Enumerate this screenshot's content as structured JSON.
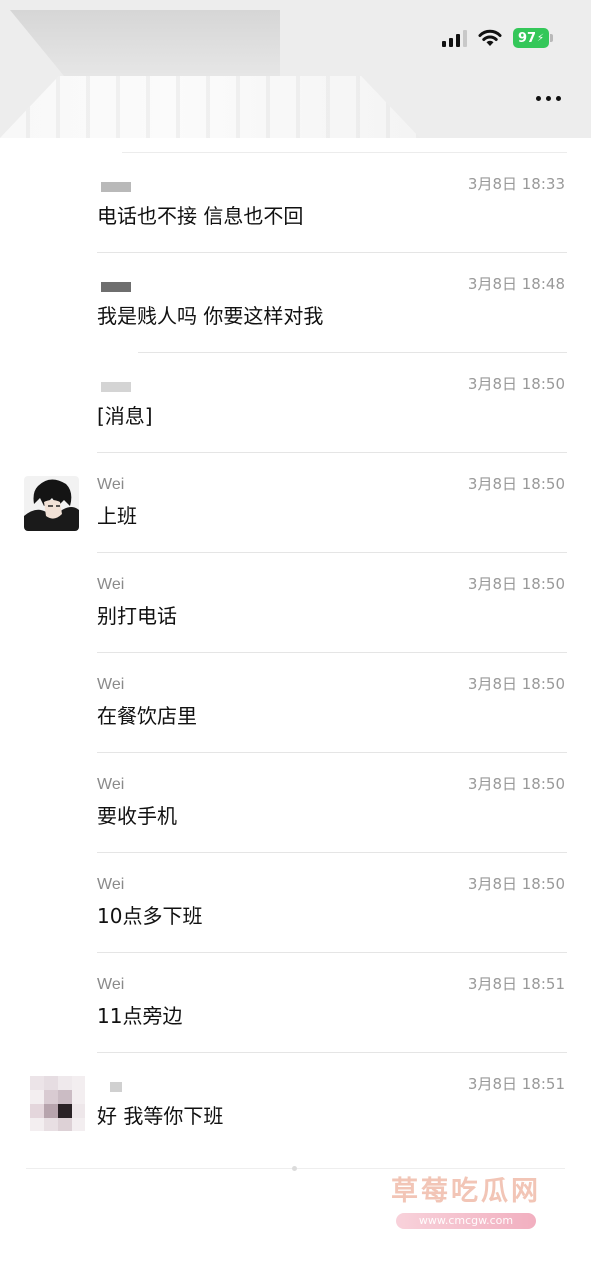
{
  "status_bar": {
    "battery": "97",
    "signal_icon": "cellular-signal-icon",
    "wifi_icon": "wifi-icon",
    "battery_icon": "battery-charging-icon"
  },
  "header": {
    "more_icon": "more-dots-icon"
  },
  "messages": [
    {
      "sender": "",
      "time": "3月8日 18:33",
      "text": "电话也不接 信息也不回"
    },
    {
      "sender": "",
      "time": "3月8日 18:48",
      "text": "我是贱人吗 你要这样对我"
    },
    {
      "sender": "",
      "time": "3月8日 18:50",
      "text": "[消息]"
    },
    {
      "sender": "Wei",
      "time": "3月8日 18:50",
      "text": "上班"
    },
    {
      "sender": "Wei",
      "time": "3月8日 18:50",
      "text": "别打电话"
    },
    {
      "sender": "Wei",
      "time": "3月8日 18:50",
      "text": "在餐饮店里"
    },
    {
      "sender": "Wei",
      "time": "3月8日 18:50",
      "text": "要收手机"
    },
    {
      "sender": "Wei",
      "time": "3月8日 18:50",
      "text": "10点多下班"
    },
    {
      "sender": "Wei",
      "time": "3月8日 18:51",
      "text": "11点旁边"
    },
    {
      "sender": "",
      "time": "3月8日 18:51",
      "text": "好 我等你下班"
    }
  ],
  "watermark": {
    "title": "草莓吃瓜网",
    "url": "www.cmcgw.com"
  },
  "colors": {
    "battery_green": "#34c759",
    "header_bg": "#ededed",
    "time_gray": "#999999"
  }
}
